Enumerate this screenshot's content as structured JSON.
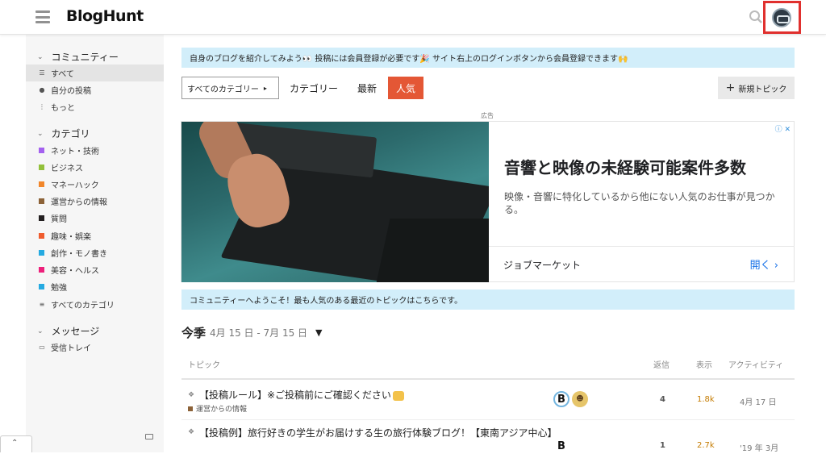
{
  "header": {
    "logo": "BlogHunt"
  },
  "sidebar": {
    "sections": [
      {
        "label": "コミュニティー"
      },
      {
        "label": "カテゴリ"
      },
      {
        "label": "メッセージ"
      }
    ],
    "community_items": [
      {
        "label": "すべて",
        "icon": "layers-icon"
      },
      {
        "label": "自分の投稿",
        "icon": "user-icon"
      },
      {
        "label": "もっと",
        "icon": "ellipsis-vertical-icon"
      }
    ],
    "categories": [
      {
        "label": "ネット・技術",
        "color": "#a461ef"
      },
      {
        "label": "ビジネス",
        "color": "#92c03a"
      },
      {
        "label": "マネーハック",
        "color": "#f1862a"
      },
      {
        "label": "運営からの情報",
        "color": "#8c6238"
      },
      {
        "label": "質問",
        "color": "#231f20"
      },
      {
        "label": "趣味・娯楽",
        "color": "#ef5c2e"
      },
      {
        "label": "創作・モノ書き",
        "color": "#25aae1"
      },
      {
        "label": "美容・ヘルス",
        "color": "#ed207b"
      },
      {
        "label": "勉強",
        "color": "#25aae1"
      },
      {
        "label": "すべてのカテゴリ",
        "icon": "list-icon"
      }
    ],
    "messages_items": [
      {
        "label": "受信トレイ",
        "icon": "inbox-icon"
      }
    ]
  },
  "notice_top": "自身のブログを紹介してみよう👀 投稿には会員登録が必要です🎉 サイト右上のログインボタンから会員登録できます🙌",
  "nav": {
    "category_dropdown": "すべてのカテゴリー",
    "tabs": [
      {
        "label": "カテゴリー",
        "active": false
      },
      {
        "label": "最新",
        "active": false
      },
      {
        "label": "人気",
        "active": true
      }
    ],
    "new_topic": "新規トピック"
  },
  "ad": {
    "label": "広告",
    "title": "音響と映像の未経験可能案件多数",
    "description": "映像・音響に特化しているから他にない人気のお仕事が見つかる。",
    "advertiser": "ジョブマーケット",
    "cta": "開く"
  },
  "notice_welcome": "コミュニティーへようこそ！最も人気のある最近のトピックはこちらです。",
  "period": {
    "label": "今季",
    "range": "4月 15 日 - 7月 15 日"
  },
  "table": {
    "headers": {
      "topic": "トピック",
      "replies": "返信",
      "views": "表示",
      "activity": "アクティビティ"
    },
    "rows": [
      {
        "title": "【投稿ルール】※ご投稿前にご確認ください",
        "category": "運営からの情報",
        "replies": "4",
        "views": "1.8k",
        "activity": "4月 17 日"
      },
      {
        "title": "【投稿例】旅行好きの学生がお届けする生の旅行体験ブログ！【東南アジア中心】",
        "category": "",
        "replies": "1",
        "views": "2.7k",
        "activity": "'19 年 3月"
      }
    ]
  }
}
